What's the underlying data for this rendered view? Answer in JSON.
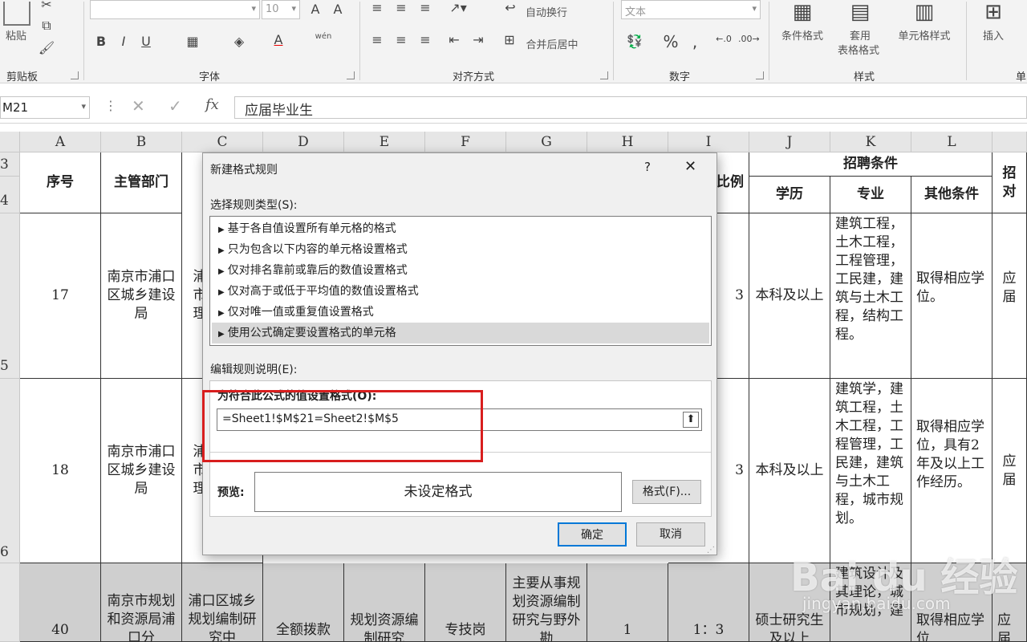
{
  "ribbon": {
    "groups": {
      "clipboard": "剪贴板",
      "font": "字体",
      "alignment": "对齐方式",
      "number": "数字",
      "styles": "样式",
      "cells_partial": "单"
    },
    "paste": "粘贴",
    "font_size": "10",
    "wrap_text": "自动换行",
    "merge_center": "合并后居中",
    "number_format": "文本",
    "conditional_format": "条件格式",
    "table_format_1": "套用",
    "table_format_2": "表格格式",
    "cell_styles": "单元格样式",
    "insert": "插入",
    "phonetic": "wén"
  },
  "formula_bar": {
    "name_box": "M21",
    "fx": "fx",
    "content": "应届毕业生"
  },
  "columns": [
    "A",
    "B",
    "C",
    "D",
    "E",
    "F",
    "G",
    "H",
    "I",
    "J",
    "K",
    "L",
    ""
  ],
  "rows": [
    "3",
    "4",
    "5",
    "6"
  ],
  "headers": {
    "seq": "序号",
    "dept": "主管部门",
    "ratio_partial": "比例",
    "conditions": "招聘条件",
    "degree": "学历",
    "major": "专业",
    "other": "其他条件",
    "last_partial": "招对"
  },
  "table_rows": [
    {
      "seq": "17",
      "dept": "南京市浦口区城乡建设局",
      "c": "浦市理",
      "ratio": "3",
      "degree": "本科及以上",
      "major": "建筑工程，土木工程，工程管理，工民建，建筑与土木工程，结构工程。",
      "other": "取得相应学位。",
      "last": "应届"
    },
    {
      "seq": "18",
      "dept": "南京市浦口区城乡建设局",
      "c": "浦市理",
      "ratio": "3",
      "degree": "本科及以上",
      "major": "建筑学，建筑工程，土木工程，工程管理，工民建，建筑与土木工程，城市规划。",
      "other": "取得相应学位，具有2年及以上工作经历。",
      "last": "应届"
    },
    {
      "seq": "40",
      "dept": "南京市规划和资源局浦口分",
      "c": "浦口区城乡规划编制研究中",
      "d": "全额拨款",
      "e": "规划资源编制研究",
      "f": "专技岗",
      "g": "主要从事规划资源编制研究与野外勘",
      "h": "1",
      "ratio": "1：3",
      "degree": "硕士研究生及以上",
      "major": "建筑设计及其理论，城市规划，建",
      "other": "取得相应学位",
      "last": "应届"
    }
  ],
  "dialog": {
    "title": "新建格式规则",
    "help": "?",
    "select_type_label": "选择规则类型(S):",
    "rule_types": [
      "基于各自值设置所有单元格的格式",
      "只为包含以下内容的单元格设置格式",
      "仅对排名靠前或靠后的数值设置格式",
      "仅对高于或低于平均值的数值设置格式",
      "仅对唯一值或重复值设置格式",
      "使用公式确定要设置格式的单元格"
    ],
    "edit_desc_label": "编辑规则说明(E):",
    "formula_label": "为符合此公式的值设置格式(O):",
    "formula_value": "=Sheet1!$M$21=Sheet2!$M$5",
    "preview_label": "预览:",
    "preview_text": "未设定格式",
    "format_button": "格式(F)...",
    "ok_button": "确定",
    "cancel_button": "取消"
  },
  "watermark": {
    "logo": "Bai du 经验",
    "url": "jingyan.baidu.com"
  }
}
